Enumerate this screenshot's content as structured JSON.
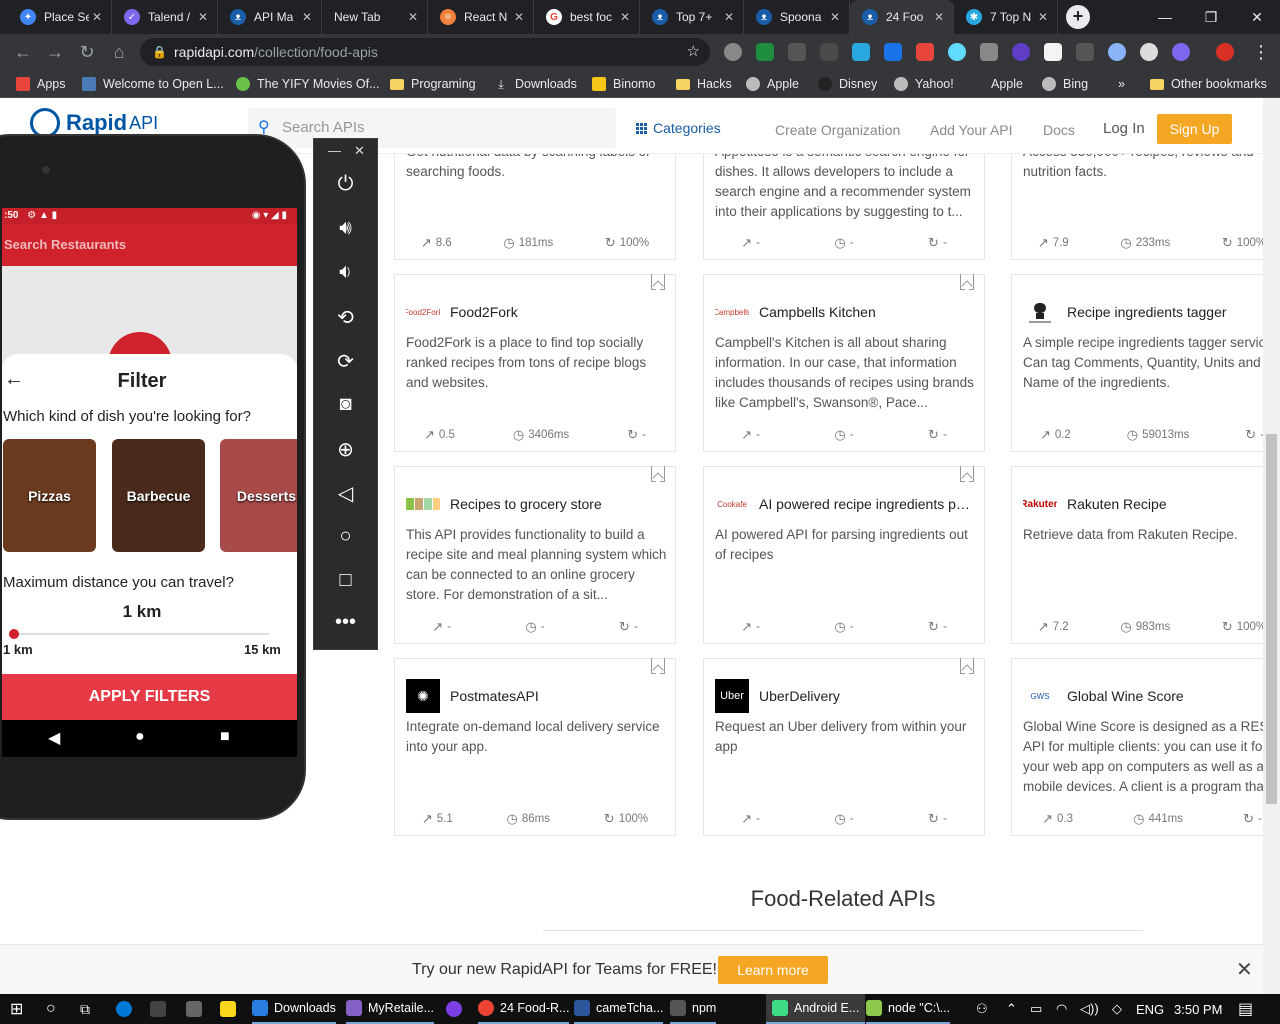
{
  "browser": {
    "tabs": [
      {
        "label": "Place Se",
        "color": "#4285f4"
      },
      {
        "label": "Talend /",
        "color": "#7b68ee"
      },
      {
        "label": "API Ma",
        "color": "#1a5ea8"
      },
      {
        "label": "New Tab",
        "color": ""
      },
      {
        "label": "React N",
        "color": "#f0803c"
      },
      {
        "label": "best foc",
        "color": "#ea4335"
      },
      {
        "label": "Top 7+",
        "color": "#1a5ea8"
      },
      {
        "label": "Spoona",
        "color": "#1a5ea8"
      },
      {
        "label": "24 Foo",
        "color": "#1a5ea8"
      },
      {
        "label": "7 Top N",
        "color": "#29a8e0"
      }
    ],
    "url_domain": "rapidapi.com",
    "url_path": "/collection/food-apis",
    "bookmarks": [
      {
        "label": "Apps"
      },
      {
        "label": "Welcome to Open L..."
      },
      {
        "label": "The YIFY Movies Of..."
      },
      {
        "label": "Programing"
      },
      {
        "label": "Downloads"
      },
      {
        "label": "Binomo"
      },
      {
        "label": "Hacks"
      },
      {
        "label": "Apple"
      },
      {
        "label": "Disney"
      },
      {
        "label": "Yahoo!"
      },
      {
        "label": "Apple"
      },
      {
        "label": "Bing"
      }
    ],
    "overflow": "»",
    "other_bookmarks": "Other bookmarks"
  },
  "header": {
    "logo_main": "Rapid",
    "logo_api": "API",
    "search_placeholder": "Search APIs",
    "categories": "Categories",
    "create_org": "Create Organization",
    "add_api": "Add Your API",
    "docs": "Docs",
    "login": "Log In",
    "signup": "Sign Up"
  },
  "top_cards": [
    {
      "desc": "Get nutritional data by scanning labels or searching foods.",
      "popularity": "8.6",
      "latency": "181ms",
      "success": "100%"
    },
    {
      "desc": "Appetitoso is a semantic search engine for dishes. It allows developers to include a search engine and a recommender system into their applications by suggesting to t...",
      "popularity": "-",
      "latency": "-",
      "success": "-"
    },
    {
      "desc": "Access 330,000+ recipes, reviews and nutrition facts.",
      "popularity": "7.9",
      "latency": "233ms",
      "success": "100%"
    }
  ],
  "cards": [
    {
      "title": "Food2Fork",
      "logo": "Food2Fork",
      "desc": "Food2Fork is a place to find top socially ranked recipes from tons of recipe blogs and websites.",
      "popularity": "0.5",
      "latency": "3406ms",
      "success": "-"
    },
    {
      "title": "Campbells Kitchen",
      "logo": "Campbells",
      "desc": "Campbell's Kitchen is all about sharing information. In our case, that information includes thousands of recipes using brands like Campbell's, Swanson®, Pace...",
      "popularity": "-",
      "latency": "-",
      "success": "-"
    },
    {
      "title": "Recipe ingredients tagger",
      "logo": "",
      "desc": "A simple recipe ingredients tagger service. Can tag Comments, Quantity, Units and Name of the ingredients.",
      "popularity": "0.2",
      "latency": "59013ms",
      "success": "-"
    },
    {
      "title": "Recipes to grocery store",
      "logo": "",
      "desc": "This API provides functionality to build a recipe site and meal planning system which can be connected to an online grocery store. For demonstration of a sit...",
      "popularity": "-",
      "latency": "-",
      "success": "-"
    },
    {
      "title": "AI powered recipe ingredients pars...",
      "logo": "Cookafe",
      "desc": "AI powered API for parsing ingredients out of recipes",
      "popularity": "-",
      "latency": "-",
      "success": "-"
    },
    {
      "title": "Rakuten Recipe",
      "logo": "Rakuten",
      "desc": "Retrieve data from Rakuten Recipe.",
      "popularity": "7.2",
      "latency": "983ms",
      "success": "100%"
    },
    {
      "title": "PostmatesAPI",
      "logo": "",
      "desc": "Integrate on-demand local delivery service into your app.",
      "popularity": "5.1",
      "latency": "86ms",
      "success": "100%"
    },
    {
      "title": "UberDelivery",
      "logo": "Uber",
      "desc": "Request an Uber delivery from within your app",
      "popularity": "-",
      "latency": "-",
      "success": "-"
    },
    {
      "title": "Global Wine Score",
      "logo": "GWS",
      "desc": "Global Wine Score is designed as a REST API for multiple clients: you can use it for your web app on computers as well as an mobile devices. A client is a program that",
      "popularity": "0.3",
      "latency": "441ms",
      "success": "-"
    }
  ],
  "section_title": "Food-Related APIs",
  "promo": {
    "text": "Try our new RapidAPI for Teams for FREE!",
    "button": "Learn more",
    "close": "✕"
  },
  "emulator": {
    "status_time": ":50",
    "search_placeholder": "Search Restaurants",
    "filter_title": "Filter",
    "dish_question": "Which kind of dish you're looking for?",
    "dishes": [
      {
        "label": "Pizzas",
        "color": "#6b3a1f"
      },
      {
        "label": "Barbecue",
        "color": "#4a2a1a"
      },
      {
        "label": "Desserts",
        "color": "#a84a4a"
      }
    ],
    "distance_question": "Maximum distance you can travel?",
    "distance_value": "1 km",
    "distance_fraction": 0,
    "min_label": "1 km",
    "max_label": "15 km",
    "apply": "APPLY FILTERS"
  },
  "taskbar": {
    "items": [
      {
        "label": "Downloads",
        "color": "#2a7de1"
      },
      {
        "label": "MyRetaile...",
        "color": "#8661c5"
      },
      {
        "label": "24 Food-R...",
        "color": "#ea4335"
      },
      {
        "label": "cameTcha...",
        "color": "#2b579a"
      },
      {
        "label": "npm",
        "color": "#555555"
      },
      {
        "label": "Android E...",
        "color": "#3ddc84"
      },
      {
        "label": "node \"C:\\...",
        "color": "#8cc84b"
      }
    ],
    "lang": "ENG",
    "time": "3:50 PM"
  }
}
